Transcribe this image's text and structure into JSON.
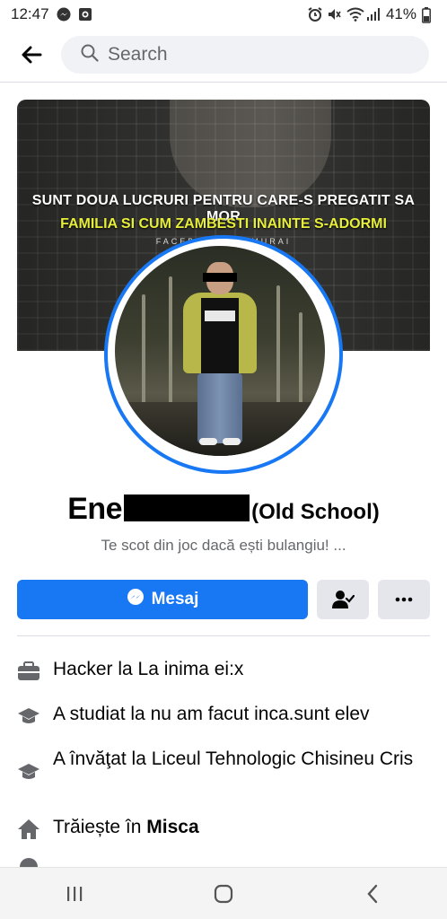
{
  "status_bar": {
    "time": "12:47",
    "battery": "41%",
    "icons": [
      "messenger-icon",
      "notification-icon",
      "alarm-icon",
      "mute-icon",
      "wifi-icon",
      "signal-icon",
      "battery-icon"
    ]
  },
  "header": {
    "search_placeholder": "Search",
    "back_icon": "arrow-left-icon"
  },
  "cover": {
    "line1": "SUNT DOUA LUCRURI PENTRU CARE-S PREGATIT SA MOR",
    "line2": "FAMILIA SI CUM ZAMBESTI INAINTE S-ADORMI",
    "line3": "FACEBOOK          DSAMURAI"
  },
  "profile": {
    "name_visible": "Ene",
    "name_suffix": "(Old School)",
    "bio": "Te scot din joc dacă ești bulangiu! ..."
  },
  "actions": {
    "message_label": "Mesaj",
    "message_icon": "messenger-icon",
    "friend_icon": "friend-check-icon",
    "more_icon": "more-dots-icon"
  },
  "info": [
    {
      "icon": "briefcase-icon",
      "text": "Hacker la La inima ei:x"
    },
    {
      "icon": "graduation-cap-icon",
      "text": "A studiat la nu am facut inca.sunt elev"
    },
    {
      "icon": "graduation-cap-icon",
      "text": "A învăţat la Liceul Tehnologic Chisineu Cris"
    },
    {
      "icon": "home-icon",
      "prefix": "Trăiește în ",
      "bold": "Misca"
    }
  ],
  "colors": {
    "accent": "#1877f2",
    "secondary_button": "#e4e6eb",
    "muted_text": "#65676b"
  }
}
